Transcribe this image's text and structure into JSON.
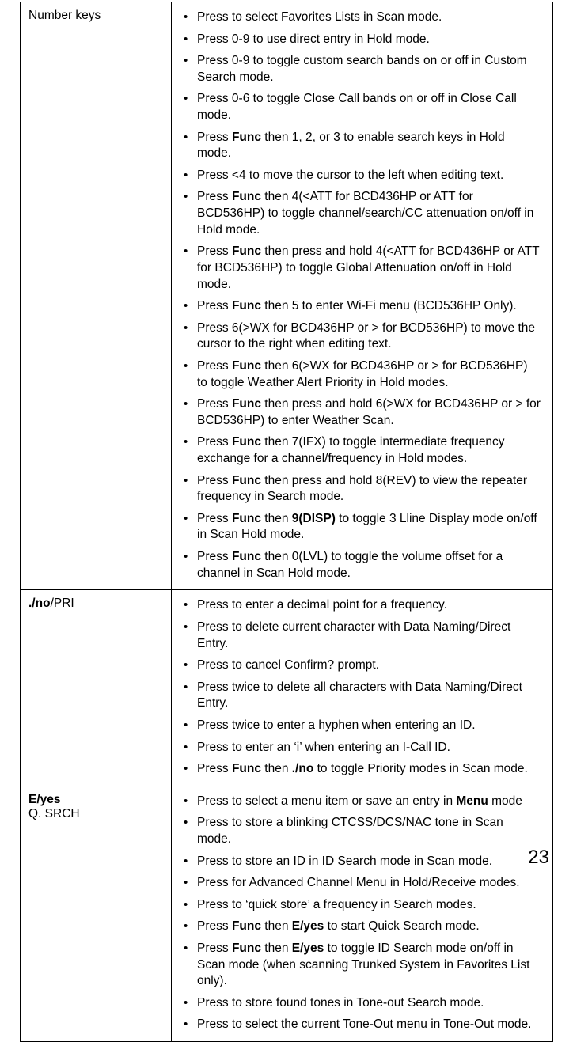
{
  "rows": [
    {
      "label_html": "Number keys",
      "items": [
        "Press to select Favorites Lists in Scan mode.",
        "Press 0-9 to use direct entry in Hold mode.",
        "Press 0-9 to toggle custom search bands on or off in Custom Search mode.",
        "Press 0-6 to toggle Close Call bands on or off in Close Call mode.",
        "Press <b>Func</b> then 1, 2, or 3 to enable search keys in Hold mode.",
        "Press &lt;4 to move the cursor to the left when editing text.",
        "Press <b>Func</b> then 4(&lt;ATT for BCD436HP or ATT for BCD536HP) to toggle channel/search/CC attenuation on/off in Hold mode.",
        "Press <b>Func</b> then press and hold 4(&lt;ATT for BCD436HP or ATT for BCD536HP)  to toggle Global Attenuation on/off in Hold mode.",
        "Press <b>Func</b> then 5 to enter Wi-Fi menu (BCD536HP Only).",
        "Press 6(&gt;WX for BCD436HP or &gt; for BCD536HP) to move the cursor to the right when editing text.",
        "Press <b>Func</b> then 6(&gt;WX for BCD436HP or &gt; for BCD536HP) to toggle Weather Alert Priority in Hold modes.",
        "Press <b>Func</b> then press and hold 6(&gt;WX for BCD436HP or &gt; for BCD536HP) to enter Weather Scan.",
        "Press <b>Func</b> then 7(IFX) to toggle intermediate frequency exchange for a channel/frequency in Hold modes.",
        "Press <b>Func</b> then press and hold 8(REV) to view the repeater frequency in Search mode.",
        "Press <b>Func</b> then <b>9(DISP)</b> to toggle 3 Lline Display mode on/off in Scan Hold mode.",
        "Press <b>Func</b> then 0(LVL) to toggle the volume offset for a channel in Scan Hold mode."
      ]
    },
    {
      "label_html": "<b>./no</b>/PRI",
      "items": [
        "Press to enter a decimal point for a frequency.",
        "Press to delete current character with Data Naming/Direct Entry.",
        "Press to cancel Confirm? prompt.",
        "Press twice to delete all characters with Data Naming/Direct Entry.",
        "Press twice to enter a hyphen when entering an ID.",
        "Press to enter an ‘i’ when entering an I-Call ID.",
        "Press <b>Func</b> then <b>./no</b> to toggle Priority modes in Scan mode."
      ]
    },
    {
      "label_html": "<b>E/yes</b><br>Q. SRCH",
      "items": [
        "Press to select a menu item or save an entry in <b>Menu</b> mode",
        "Press to store a blinking CTCSS/DCS/NAC tone in Scan mode.",
        "Press to store an ID in ID Search mode in Scan mode.",
        "Press for Advanced Channel Menu in Hold/Receive modes.",
        "Press to ‘quick store’ a frequency in Search modes.",
        "Press <b>Func</b> then <b>E/yes</b> to start Quick Search mode.",
        "Press <b>Func</b> then <b>E/yes</b> to toggle ID Search mode on/off in Scan mode (when scanning Trunked System in Favorites List only).",
        "Press to store found tones in Tone-out Search mode.",
        "Press to select the current Tone-Out menu in Tone-Out mode."
      ]
    }
  ],
  "page_number": "23"
}
